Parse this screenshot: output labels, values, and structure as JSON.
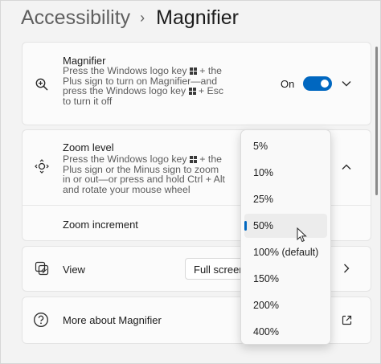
{
  "breadcrumb": {
    "parent": "Accessibility",
    "separator": "›",
    "current": "Magnifier"
  },
  "magnifier": {
    "title": "Magnifier",
    "desc_1": "Press the Windows logo key",
    "desc_2": " + the Plus sign to turn on Magnifier—and press the Windows logo key",
    "desc_3": " + Esc to turn it off",
    "toggle_label": "On",
    "toggle_on": true,
    "icon": "magnifier-zoom-icon"
  },
  "zoom_level": {
    "title": "Zoom level",
    "desc_1": "Press the Windows logo key",
    "desc_2": " + the Plus sign or the Minus sign to zoom in or out—or press and hold Ctrl + Alt and rotate your mouse wheel",
    "icon": "zoom-level-icon"
  },
  "zoom_increment": {
    "label": "Zoom increment",
    "options": [
      "5%",
      "10%",
      "25%",
      "50%",
      "100% (default)",
      "150%",
      "200%",
      "400%"
    ],
    "selected_index": 3
  },
  "view": {
    "label": "View",
    "value": "Full screen",
    "icon": "view-mode-icon"
  },
  "more": {
    "label": "More about Magnifier",
    "icon": "help-icon",
    "link_icon": "open-external-icon"
  },
  "colors": {
    "accent": "#0067c0",
    "background": "#f3f3f3",
    "card": "#fbfbfb"
  }
}
